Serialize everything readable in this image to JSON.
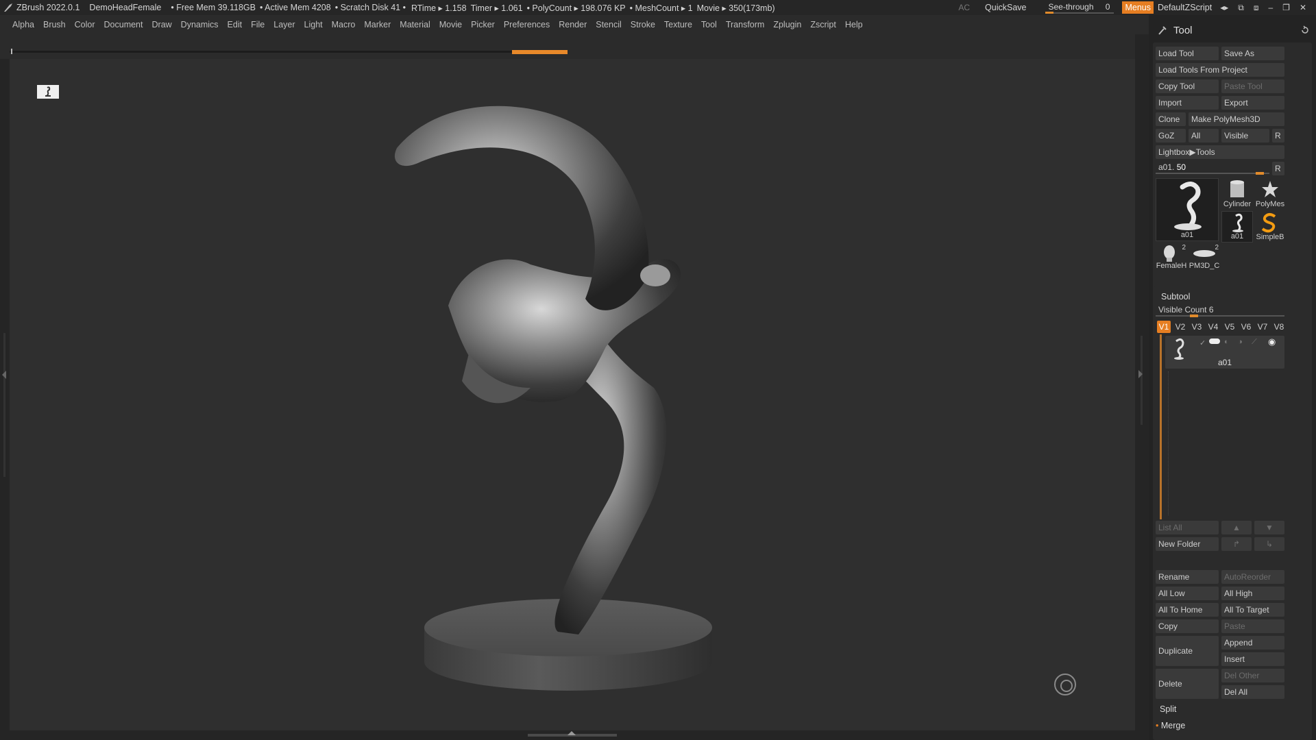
{
  "app": {
    "title": "ZBrush 2022.0.1",
    "document": "DemoHeadFemale",
    "free_mem": "• Free Mem 39.118GB",
    "active_mem": "• Active Mem 4208",
    "scratch_disk": "• Scratch Disk 41 •",
    "rtime": "RTime ▸ 1.158",
    "timer": "Timer ▸ 1.061",
    "polycount": "• PolyCount ▸ 198.076 KP",
    "meshcount": "• MeshCount ▸ 1",
    "movie": "Movie ▸ 350(173mb)"
  },
  "titlebar": {
    "ac": "AC",
    "quicksave": "QuickSave",
    "see_through_label": "See-through",
    "see_through_value": "0",
    "menus": "Menus",
    "default_zscript": "DefaultZScript"
  },
  "menu": [
    "Alpha",
    "Brush",
    "Color",
    "Document",
    "Draw",
    "Dynamics",
    "Edit",
    "File",
    "Layer",
    "Light",
    "Macro",
    "Marker",
    "Material",
    "Movie",
    "Picker",
    "Preferences",
    "Render",
    "Stencil",
    "Stroke",
    "Texture",
    "Tool",
    "Transform",
    "Zplugin",
    "Zscript",
    "Help"
  ],
  "tool_panel": {
    "title": "Tool",
    "load_tool": "Load Tool",
    "save_as": "Save As",
    "load_tools_from_project": "Load Tools From Project",
    "copy_tool": "Copy Tool",
    "paste_tool": "Paste Tool",
    "import": "Import",
    "export": "Export",
    "clone": "Clone",
    "make_polymesh": "Make PolyMesh3D",
    "goz": "GoZ",
    "all": "All",
    "visible": "Visible",
    "r": "R",
    "lightbox_tools": "Lightbox▶Tools",
    "current_tool_label": "a01.",
    "current_tool_value": "50",
    "current_tool_level": 0.95,
    "tiles": {
      "main": "a01",
      "cylinder": "Cylinder",
      "polymesh": "PolyMes",
      "a01_small": "a01",
      "simpleb": "SimpleB",
      "female": "FemaleH",
      "female_count": "2",
      "pm3d": "PM3D_C",
      "pm3d_count": "2"
    }
  },
  "subtool": {
    "title": "Subtool",
    "visible_count": "Visible Count 6",
    "visible_count_level": 0.3,
    "tabs": [
      "V1",
      "V2",
      "V3",
      "V4",
      "V5",
      "V6",
      "V7",
      "V8"
    ],
    "item_name": "a01",
    "list_all": "List All",
    "new_folder": "New Folder",
    "rename": "Rename",
    "autoreorder": "AutoReorder",
    "all_low": "All Low",
    "all_high": "All High",
    "all_to_home": "All To Home",
    "all_to_target": "All To Target",
    "copy": "Copy",
    "paste": "Paste",
    "duplicate": "Duplicate",
    "append": "Append",
    "insert": "Insert",
    "delete": "Delete",
    "del_other": "Del Other",
    "del_all": "Del All",
    "split": "Split",
    "merge": "Merge"
  },
  "colors": {
    "accent": "#e67e22",
    "panel_bg": "#232323",
    "viewport_bg": "#2f2f2f"
  }
}
